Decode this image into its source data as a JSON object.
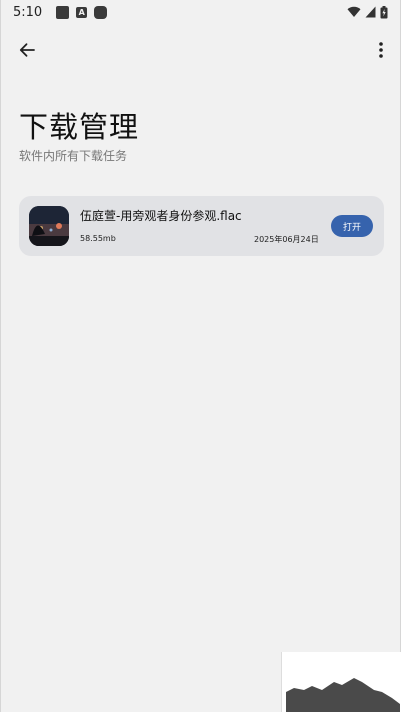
{
  "status_bar": {
    "time": "5:10"
  },
  "app_bar": {
    "back_icon": "arrow-left-icon",
    "more_icon": "more-vertical-icon"
  },
  "header": {
    "title": "下载管理",
    "subtitle": "软件内所有下载任务"
  },
  "downloads": [
    {
      "name": "伍庭萱-用旁观者身份参观.flac",
      "size": "58.55mb",
      "date": "2025年06月24日",
      "action_label": "打开"
    }
  ],
  "colors": {
    "background": "#f1f1f1",
    "card": "#e1e2e5",
    "accent": "#3663ad"
  }
}
